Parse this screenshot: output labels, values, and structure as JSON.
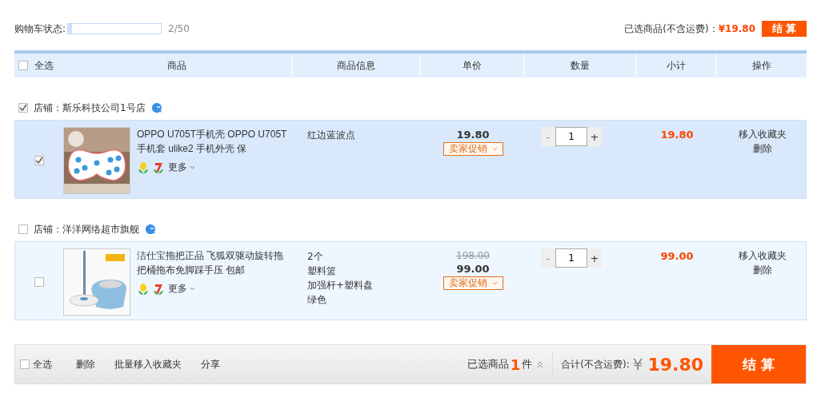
{
  "cart_status": {
    "label": "购物车状态:",
    "level": 0.04,
    "count": "2/50"
  },
  "summary": {
    "label": "已选商品(不含运费)：",
    "currency": "¥",
    "total": "19.80",
    "checkout": "结 算"
  },
  "header": {
    "select_all": {
      "label": "全选",
      "checked": false
    },
    "columns": [
      "商品",
      "商品信息",
      "单价",
      "数量",
      "小计",
      "操作"
    ]
  },
  "shops": [
    {
      "name": "店铺：斯乐科技公司1号店",
      "checked": true,
      "items": [
        {
          "selected": true,
          "title": "OPPO U705T手机壳 OPPO U705T手机套 ulike2 手机外壳 保",
          "more": "更多",
          "sku": [
            "红边蓝波点"
          ],
          "price": "19.80",
          "promo": "卖家促销",
          "minus": "-",
          "quantity": "1",
          "plus": "+",
          "subtotal": "19.80",
          "actions": [
            "移入收藏夹",
            "删除"
          ]
        }
      ]
    },
    {
      "name": "店铺：洋洋网络超市旗舰",
      "checked": false,
      "items": [
        {
          "selected": false,
          "title": "洁仕宝拖把正品 飞狐双驱动旋转拖把桶拖布免脚踩手压 包邮",
          "more": "更多",
          "sku": [
            "2个",
            "塑料篮",
            "加强杆+塑料盘",
            "绿色"
          ],
          "original_price": "198.00",
          "price": "99.00",
          "promo": "卖家促销",
          "minus": "-",
          "quantity": "1",
          "plus": "+",
          "subtotal": "99.00",
          "actions": [
            "移入收藏夹",
            "删除"
          ]
        }
      ]
    }
  ],
  "footer": {
    "select_all": {
      "label": "全选",
      "checked": false
    },
    "links": [
      "删除",
      "批量移入收藏夹",
      "分享"
    ],
    "selected_label": "已选商品",
    "selected_count": "1",
    "selected_unit": "件",
    "total_label": "合计(不含运费):",
    "currency": "¥",
    "total": "19.80",
    "checkout": "结 算"
  }
}
